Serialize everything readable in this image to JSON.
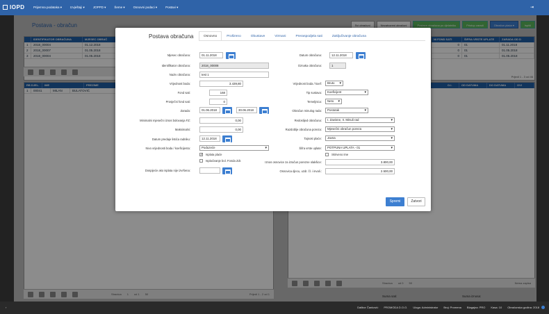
{
  "app": {
    "logo": "IOPD",
    "menu": [
      "Prijemna podataka ▾",
      "Izvještaji ▾",
      "JOPPD ▾",
      "Šeme ▾",
      "Osnovni podaci ▾",
      "Postavi ▾"
    ],
    "exit": "⇥"
  },
  "page": {
    "title": "Postava - obračun",
    "buttons": [
      "Svi obračuni",
      "Nezatvoreni obračuni",
      "Postava obračuna po djelatniku",
      "Pristup zaradi",
      "Obračun plaća ▾",
      "Ispiši"
    ]
  },
  "main_table": {
    "headers": [
      "",
      "IDENTIFIKATOR OBRAČUNA",
      "MJESEC OBRAČ"
    ],
    "rows": [
      [
        "1",
        "2018_00004",
        "01.12.2018"
      ],
      [
        "2",
        "2018_00007",
        "01.05.2018"
      ],
      [
        "3",
        "2018_00004",
        "01.05.2018"
      ]
    ]
  },
  "right_table": {
    "headers": [
      "NI FOND SATI",
      "ŠIFRA VRSTE UPLATE",
      "ZARADA OD D"
    ],
    "rows": [
      [
        "0",
        "01",
        "01.11.2018"
      ],
      [
        "0",
        "01",
        "01.05.2018"
      ],
      [
        "0",
        "01",
        "01.05.2018"
      ]
    ],
    "pager": "Prijedi 1 - 3 od 46"
  },
  "emp_table": {
    "headers": [
      "RB DJEL.",
      "IME",
      "PREZIME"
    ],
    "rows": [
      [
        "1",
        "00041",
        "MILAN",
        "BULATOVIĆ"
      ]
    ]
  },
  "emp_right": {
    "headers": [
      "O.I.",
      "OD DATUMA",
      "DO DATUMA",
      "OVI"
    ]
  },
  "left_pager": {
    "label": "Stranica",
    "of": "od 1",
    "page": "1",
    "size": "50",
    "info": "Prijedi 1 - 2 od 1"
  },
  "right_pager": {
    "label": "Stranica",
    "of": "od 0",
    "size": "50",
    "info": "Nema zapisa"
  },
  "sums": {
    "hours": "Suma sati:",
    "amount": "Suma iznosa:"
  },
  "status": [
    "Dalibor Čanković",
    "PROMODA D.O.O.",
    "Uloga: Administrator",
    "Broj: Promena",
    "Blagajna: PRO",
    "Kasa: 10",
    "Obračunska godina: 2018"
  ],
  "modal": {
    "title": "Postava obračuna",
    "tabs": [
      "Osnovno",
      "Prošireno",
      "Obustave",
      "Virmani",
      "Preraspodjela sati",
      "Zaključivanje obračuna"
    ],
    "fields": {
      "mjesec_label": "Mjesec obračuna:",
      "mjesec": "01.11.2018",
      "ident_label": "Identifikator obračuna:",
      "ident": "2018_00008",
      "naziv_label": "Naziv obračuna:",
      "naziv": "test 1",
      "vrijednost_label": "Vrijednost boda:",
      "vrijednost": "3.439,80",
      "fond_label": "Fond sati:",
      "fond": "168",
      "prosjecni_label": "Prosječni fond sati:",
      "prosjecni": "0",
      "zarada_label": "Zarada:",
      "zarada_od": "01.06.2018",
      "zarada_do": "30.06.2018",
      "min_label": "Minimalni mjesečni iznos bolovanja FZ:",
      "min": "0,00",
      "max_label": "Maksimalni:",
      "max": "0,00",
      "predaja_label": "Datum predaje listića radniku:",
      "predaja": "12.11.2018",
      "nivo_label": "Nivo vrijednosti boda / koeficijenta:",
      "nivo": "Poduzeće",
      "isplata_placa": "Isplata plaće",
      "isplata_fonda": "Isplaćivanje bol. Fonda Zdr.",
      "dospijece_label": "Dospijeće ako isplata nije izvršena:",
      "datum_label": "Datum obračuna:",
      "datum": "12.11.2018",
      "oznaka_label": "Oznaka obračuna:",
      "oznaka": "1",
      "vrboda_label": "Vrijednost boda / koef:",
      "vrboda": "Bruto",
      "tip_label": "Tip sustava:",
      "tip": "Koeficijent",
      "temelj_label": "Temeljnica:",
      "temelj": "Neto",
      "minuli_label": "Obračun minulog rada:",
      "minuli": "Postotak",
      "redoslijed_label": "Redoslijed obračuna:",
      "redoslijed": "I. Zavisne, II. Minuli rad",
      "razdoblje_label": "Razdoblje obračuna poreza:",
      "razdoblje": "Mjesečni obračun poreza",
      "tajnost_label": "Tajnost plaće:",
      "tajnost": "Javna",
      "sifra_label": "Šifra vrste uplate:",
      "sifra": "POTPUNA UPLATA - 01",
      "skriveno": "Skriveno ime",
      "iznos_label": "Iznos osnovice za izračun porezne olakšice:",
      "iznos": "3.800,00",
      "osnovica_label": "Osnovica djecu, uzdr. čl. i invali.:",
      "osnovica": "2.500,00"
    },
    "save": "Spremi",
    "close": "Zatvori"
  }
}
